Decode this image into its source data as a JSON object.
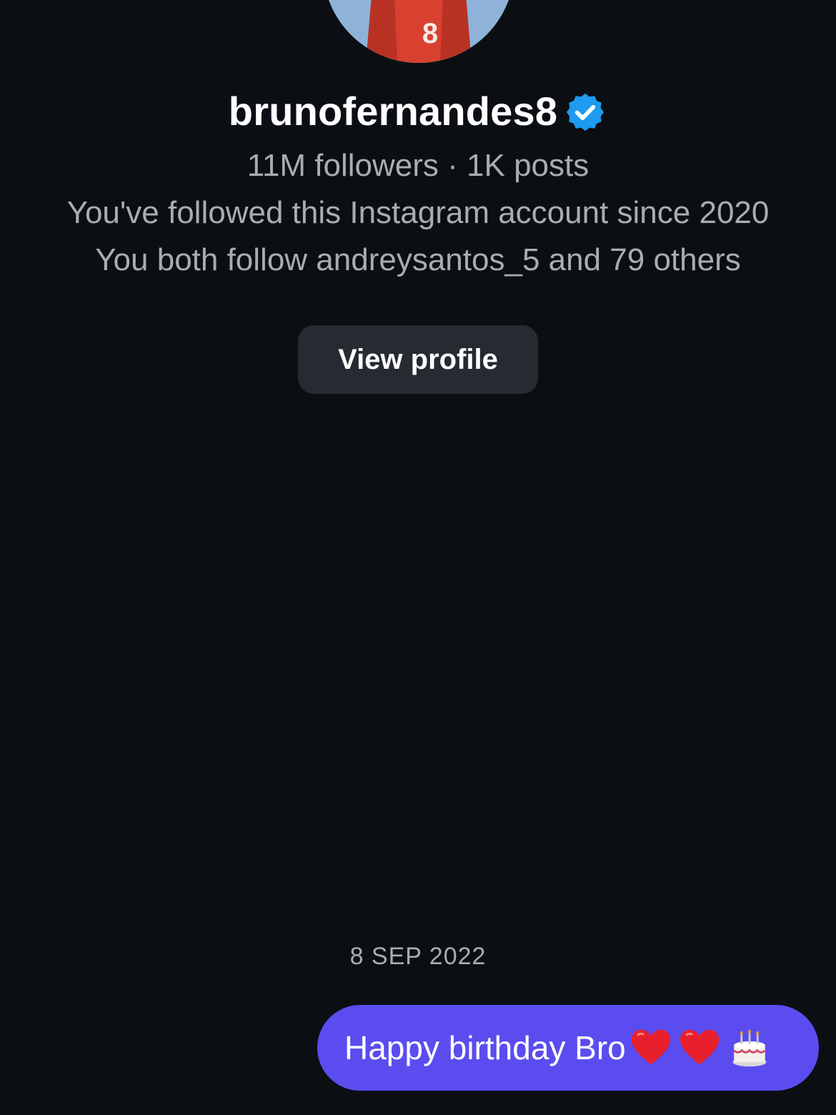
{
  "profile": {
    "username": "brunofernandes8",
    "verified_icon": "verified-badge-icon",
    "stats": "11M followers · 1K posts",
    "followed_since": "You've followed this Instagram account since 2020",
    "mutual": "You both follow andreysantos_5 and 79 others",
    "view_profile_label": "View profile",
    "jersey_number": "8"
  },
  "thread": {
    "date_separator": "8 SEP 2022",
    "messages": [
      {
        "text": "Happy birthday Bro",
        "emojis": [
          "red-heart-icon",
          "red-heart-icon",
          "birthday-cake-icon"
        ]
      }
    ]
  },
  "colors": {
    "background": "#0b0f14",
    "bubble": "#5b4cf0",
    "button": "#262a31",
    "verified": "#1d9bf0",
    "muted_text": "#a8adb4"
  }
}
